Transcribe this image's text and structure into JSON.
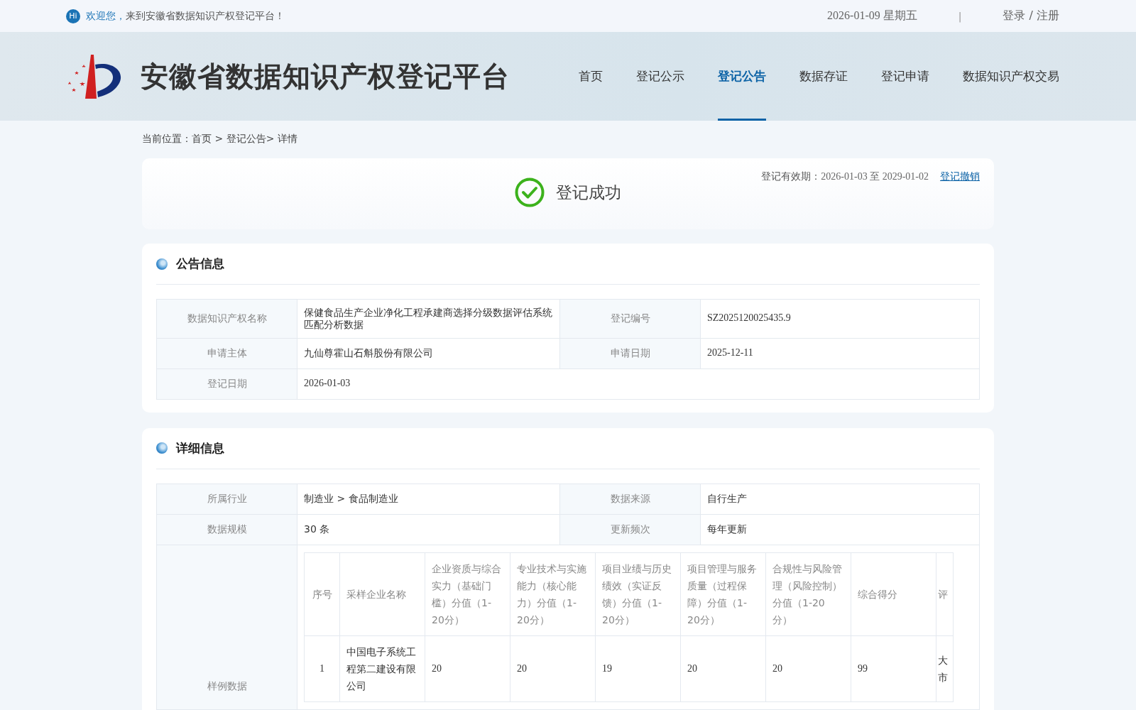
{
  "top_bar": {
    "hi_icon": "Hi",
    "greeting_highlight": "欢迎您，",
    "greeting": "来到安徽省数据知识产权登记平台！",
    "date": "2026-01-09 星期五",
    "separator": "|",
    "auth": "登录 / 注册"
  },
  "header": {
    "title": "安徽省数据知识产权登记平台",
    "nav": [
      {
        "label": "首页",
        "selected": false
      },
      {
        "label": "登记公示",
        "selected": false
      },
      {
        "label": "登记公告",
        "selected": true
      },
      {
        "label": "数据存证",
        "selected": false
      },
      {
        "label": "登记申请",
        "selected": false
      },
      {
        "label": "数据知识产权交易",
        "selected": false
      }
    ]
  },
  "breadcrumb": {
    "label": "当前位置：",
    "path": "首页 > 登记公告> 详情"
  },
  "status": {
    "title": "登记成功",
    "validity_label": "登记有效期：",
    "validity": "2026-01-03 至 2029-01-02",
    "revoke_link": "登记撤销"
  },
  "announcement": {
    "heading": "公告信息",
    "rows": [
      [
        {
          "label": "数据知识产权名称",
          "value": "保健食品生产企业净化工程承建商选择分级数据评估系统匹配分析数据"
        },
        {
          "label": "登记编号",
          "value": "SZ2025120025435.9"
        }
      ],
      [
        {
          "label": "申请主体",
          "value": "九仙尊霍山石斛股份有限公司"
        },
        {
          "label": "申请日期",
          "value": "2025-12-11"
        }
      ],
      [
        {
          "label": "登记日期",
          "value": "2026-01-03"
        }
      ]
    ]
  },
  "details": {
    "heading": "详细信息",
    "rows": [
      [
        {
          "label": "所属行业",
          "value": "制造业 > 食品制造业"
        },
        {
          "label": "数据来源",
          "value": "自行生产"
        }
      ],
      [
        {
          "label": "数据规模",
          "value": "30 条"
        },
        {
          "label": "更新频次",
          "value": "每年更新"
        }
      ]
    ],
    "sample": {
      "label": "样例数据",
      "columns": [
        "序号",
        "采样企业名称",
        "企业资质与综合实力（基础门槛）分值（1-20分）",
        "专业技术与实施能力（核心能力）分值（1-20分）",
        "项目业绩与历史绩效（实证反馈）分值（1-20分）",
        "项目管理与服务质量（过程保障）分值（1-20分）",
        "合规性与风险管理（风险控制）分值（1-20分）",
        "综合得分",
        "评"
      ],
      "rows": [
        [
          "1",
          "中国电子系统工程第二建设有限公司",
          "20",
          "20",
          "19",
          "20",
          "20",
          "99",
          "大市"
        ]
      ]
    }
  }
}
